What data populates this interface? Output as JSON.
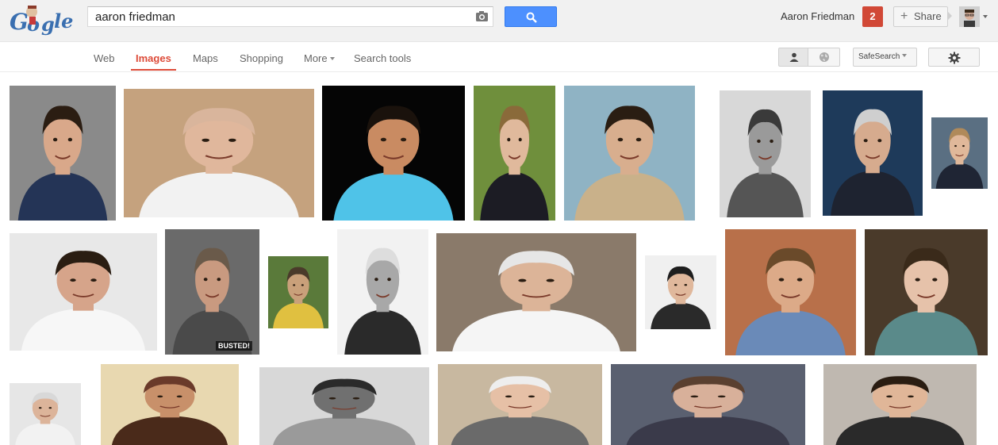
{
  "search": {
    "query": "aaron friedman"
  },
  "header": {
    "user_name": "Aaron Friedman",
    "notifications": "2",
    "share_label": "Share"
  },
  "nav": {
    "tabs": [
      {
        "label": "Web"
      },
      {
        "label": "Images"
      },
      {
        "label": "Maps"
      },
      {
        "label": "Shopping"
      },
      {
        "label": "More"
      },
      {
        "label": "Search tools"
      }
    ],
    "active_tab": "Images",
    "safesearch_label": "SafeSearch"
  },
  "colors": {
    "accent": "#dd4b39",
    "search_button": "#4d90fe",
    "notification": "#d14836"
  },
  "icons": [
    "google-doodle-logo",
    "camera-icon",
    "search-icon",
    "plus-icon",
    "avatar",
    "person-icon",
    "globe-icon",
    "gear-icon"
  ],
  "results": {
    "badge_text": "BUSTED!",
    "tiles": [
      {
        "bg": "#8a8a8a",
        "skin": "#d9a88a",
        "hair": "#2b1d12",
        "shirt": "#243456"
      },
      {
        "bg": "#c5a27e",
        "skin": "#e0b79c",
        "hair": "#d9b59c",
        "shirt": "#f2f2f2"
      },
      {
        "bg": "#050505",
        "skin": "#c98b62",
        "hair": "#1a120c",
        "shirt": "#4fc3e8"
      },
      {
        "bg": "#6f8f3c",
        "skin": "#e0b99c",
        "hair": "#8a6a3a",
        "shirt": "#1c1c24"
      },
      {
        "bg": "#8fb3c4",
        "skin": "#d8ae8e",
        "hair": "#2a1d12",
        "shirt": "#c9b18a"
      },
      {
        "bg": "#d8d8d8",
        "skin": "#9a9a9a",
        "hair": "#3a3a3a",
        "shirt": "#555555"
      },
      {
        "bg": "#1e3a5a",
        "skin": "#d6ab8e",
        "hair": "#cfcfcf",
        "shirt": "#1e2330"
      },
      {
        "bg": "#5a6f82",
        "skin": "#e0b89a",
        "hair": "#b08a5a",
        "shirt": "#1f2534"
      },
      {
        "bg": "#e8e8e8",
        "skin": "#d6a48a",
        "hair": "#2a1d12",
        "shirt": "#f7f7f7"
      },
      {
        "bg": "#6a6a6a",
        "skin": "#c99a80",
        "hair": "#6a5a4a",
        "shirt": "#4a4a4a"
      },
      {
        "bg": "#5a7a3a",
        "skin": "#c9a07a",
        "hair": "#4a3a2a",
        "shirt": "#e0c040"
      },
      {
        "bg": "#f2f2f2",
        "skin": "#a8a8a8",
        "hair": "#dddddd",
        "shirt": "#2a2a2a"
      },
      {
        "bg": "#8a7a6a",
        "skin": "#dcb498",
        "hair": "#e6e6e6",
        "shirt": "#f5f5f5"
      },
      {
        "bg": "#f0f0f0",
        "skin": "#e0b89c",
        "hair": "#1e1e1e",
        "shirt": "#2a2a2a"
      },
      {
        "bg": "#b8704a",
        "skin": "#dcaa88",
        "hair": "#6a4a2a",
        "shirt": "#6a8ab8"
      },
      {
        "bg": "#4a3a2a",
        "skin": "#e6c2aa",
        "hair": "#3a2a1a",
        "shirt": "#5a8a8a"
      },
      {
        "bg": "#e6e6e6",
        "skin": "#dcb49a",
        "hair": "#d8d8d8",
        "shirt": "#f2f2f2"
      },
      {
        "bg": "#e8d8b0",
        "skin": "#c8906a",
        "hair": "#6a3a2a",
        "shirt": "#4a2a1a"
      },
      {
        "bg": "#d8d8d8",
        "skin": "#707070",
        "hair": "#2a2a2a",
        "shirt": "#9a9a9a"
      },
      {
        "bg": "#c8b8a0",
        "skin": "#e6c0a6",
        "hair": "#eeeeee",
        "shirt": "#6a6a6a"
      },
      {
        "bg": "#5a6070",
        "skin": "#d8b09a",
        "hair": "#5a4030",
        "shirt": "#3a3a4a"
      },
      {
        "bg": "#bfb8b0",
        "skin": "#e0b698",
        "hair": "#2a1d12",
        "shirt": "#2a2a2a"
      }
    ]
  }
}
